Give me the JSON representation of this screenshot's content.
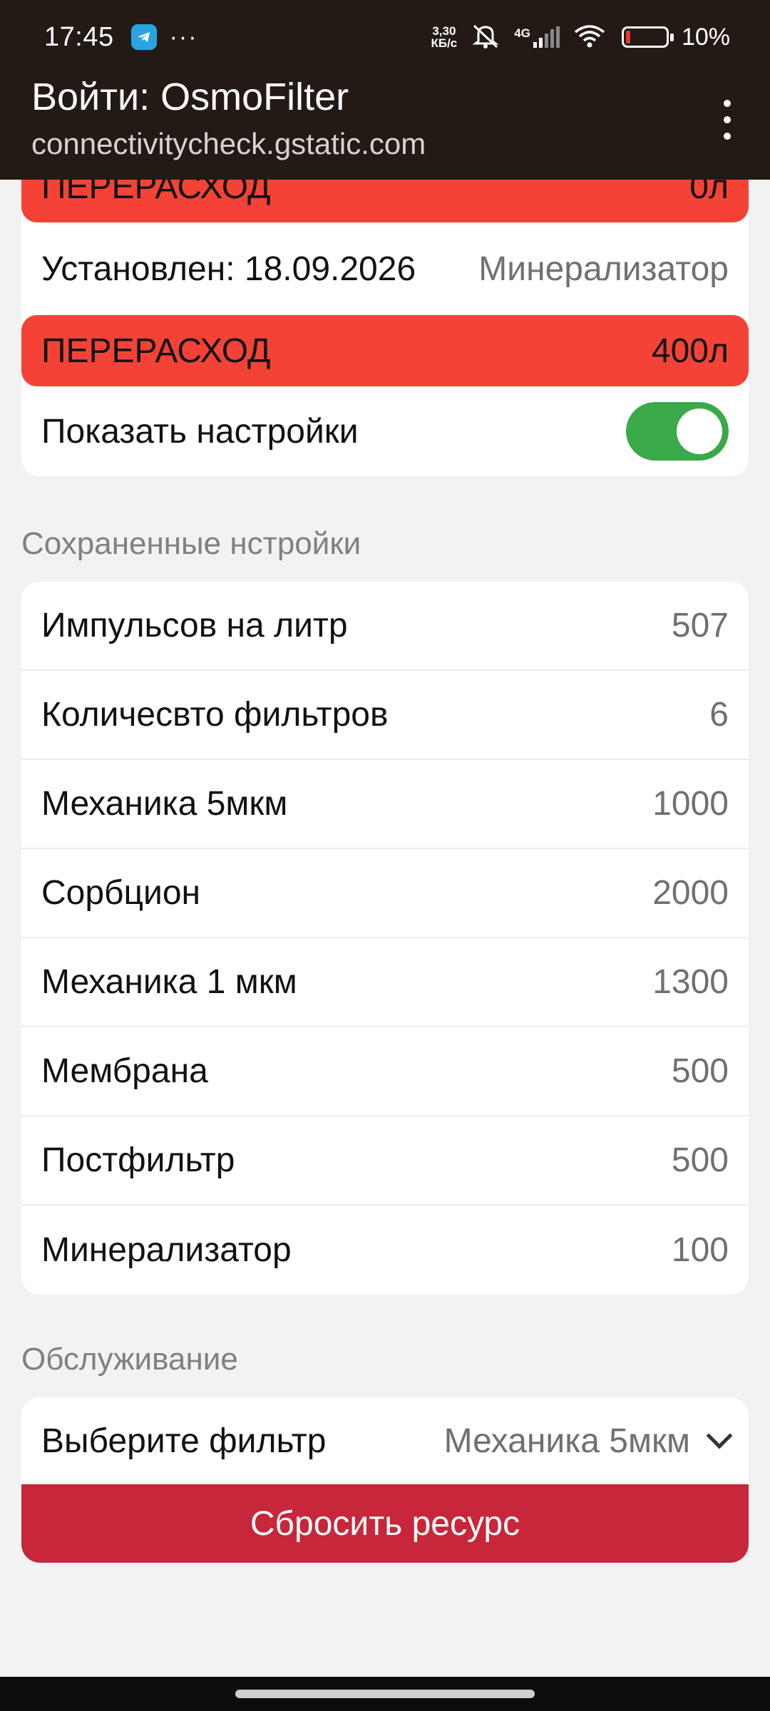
{
  "status_bar": {
    "time": "17:45",
    "net_speed_value": "3,30",
    "net_speed_unit": "КБ/с",
    "network": "4G",
    "battery_pct": "10%",
    "battery_level": 0.1
  },
  "app_bar": {
    "title": "Войти: OsmoFilter",
    "subtitle": "connectivitycheck.gstatic.com"
  },
  "status_card": {
    "top_alert": {
      "label": "ПЕРЕРАСХОД",
      "value": "0л"
    },
    "installed_label": "Установлен: 18.09.2026",
    "installed_filter": "Минерализатор",
    "alert": {
      "label": "ПЕРЕРАСХОД",
      "value": "400л"
    },
    "show_settings_label": "Показать настройки",
    "show_settings_on": true
  },
  "saved_settings": {
    "heading": "Сохраненные нстройки",
    "rows": [
      {
        "label": "Импульсов на литр",
        "value": "507"
      },
      {
        "label": "Количесвто фильтров",
        "value": "6"
      },
      {
        "label": "Механика 5мкм",
        "value": "1000"
      },
      {
        "label": "Сорбцион",
        "value": "2000"
      },
      {
        "label": "Механика 1 мкм",
        "value": "1300"
      },
      {
        "label": "Мембрана",
        "value": "500"
      },
      {
        "label": "Постфильтр",
        "value": "500"
      },
      {
        "label": "Минерализатор",
        "value": "100"
      }
    ]
  },
  "maintenance": {
    "heading": "Обслуживание",
    "select_label": "Выберите фильтр",
    "select_value": "Механика 5мкм",
    "reset_button": "Сбросить ресурс"
  },
  "colors": {
    "app_bar": "#231a16",
    "alert": "#f44336",
    "toggle_on": "#39a94a",
    "reset_button": "#c8263a"
  }
}
